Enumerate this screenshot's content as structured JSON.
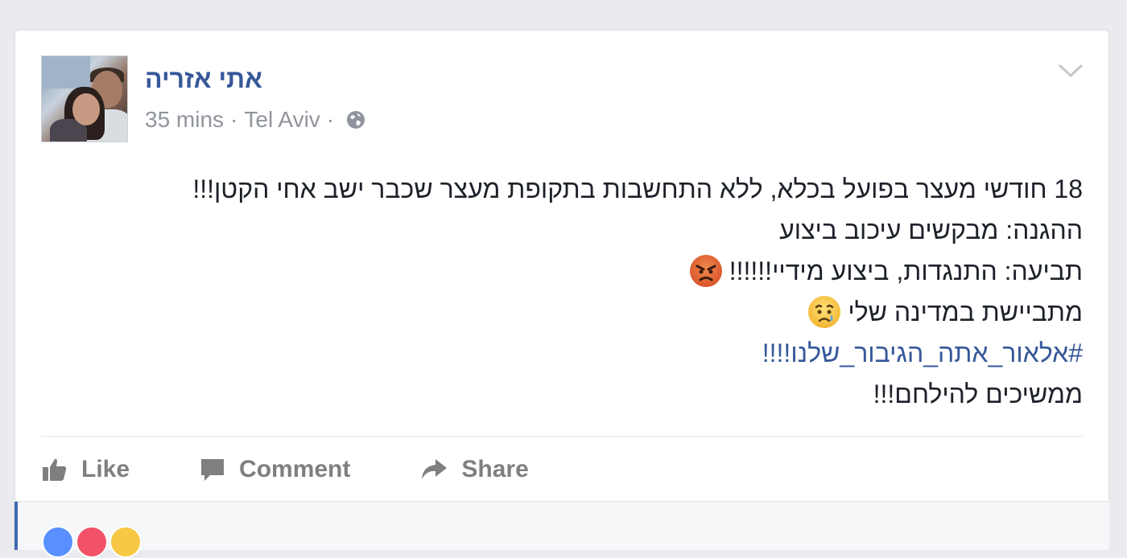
{
  "post": {
    "author_name": "אתי אזריה",
    "time": "35 mins",
    "separator": "·",
    "location": "Tel Aviv",
    "privacy_icon": "globe-icon",
    "options_icon": "chevron-down-icon",
    "text_lines": [
      "18 חודשי מעצר בפועל בכלא, ללא התחשבות בתקופת מעצר שכבר ישב אחי הקטן!!!",
      "ההגנה: מבקשים עיכוב ביצוע",
      "תביעה: התנגדות, ביצוע מידיי!!!!!!",
      "מתביישת במדינה שלי",
      "#אלאור_אתה_הגיבור_שלנו!!!!",
      "ממשיכים להילחם!!!"
    ],
    "emojis": [
      "angry-face-emoji",
      "sad-tear-face-emoji"
    ]
  },
  "actions": {
    "like_label": "Like",
    "comment_label": "Comment",
    "share_label": "Share"
  },
  "colors": {
    "link": "#365899",
    "meta": "#90949c",
    "action": "#7f7f7f",
    "accent": "#4267b2"
  }
}
